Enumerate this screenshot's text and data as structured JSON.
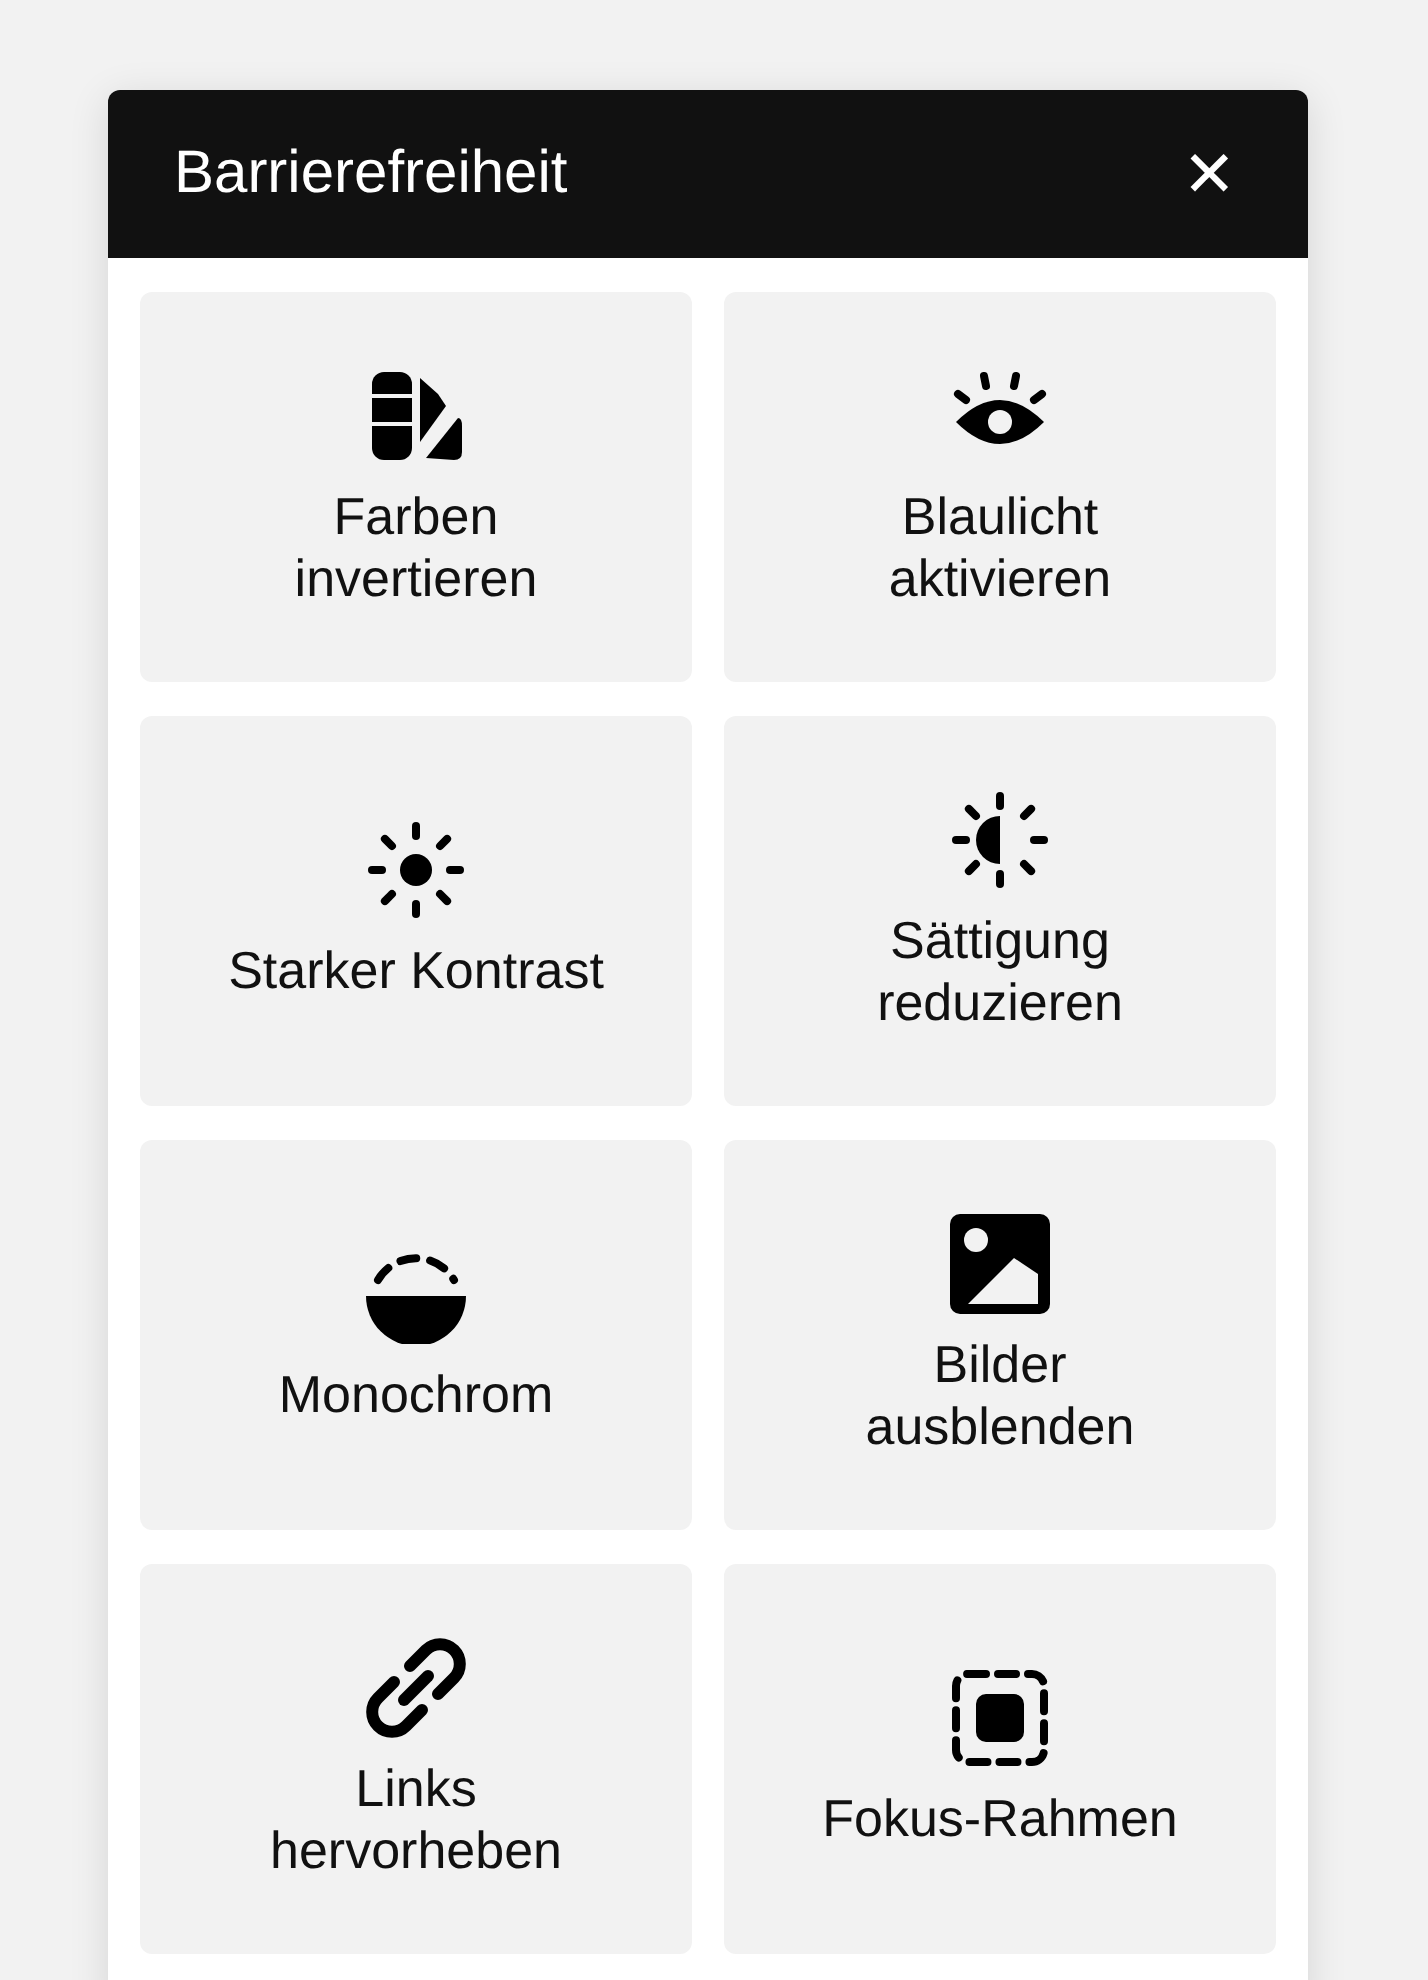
{
  "panel": {
    "title": "Barrierefreiheit",
    "close": "✕"
  },
  "options": [
    {
      "kind": "palette",
      "label": [
        "Farben",
        "invertieren"
      ]
    },
    {
      "kind": "eye",
      "label": [
        "Blaulicht",
        "aktivieren"
      ]
    },
    {
      "kind": "sun",
      "label": [
        "Starker Kontrast"
      ]
    },
    {
      "kind": "half-sun",
      "label": [
        "Sättigung",
        "reduzieren"
      ]
    },
    {
      "kind": "bowl",
      "label": [
        "Monochrom"
      ]
    },
    {
      "kind": "image",
      "label": [
        "Bilder",
        "ausblenden"
      ]
    },
    {
      "kind": "link",
      "label": [
        "Links",
        "hervorheben"
      ]
    },
    {
      "kind": "focus",
      "label": [
        "Fokus-Rahmen"
      ]
    }
  ]
}
